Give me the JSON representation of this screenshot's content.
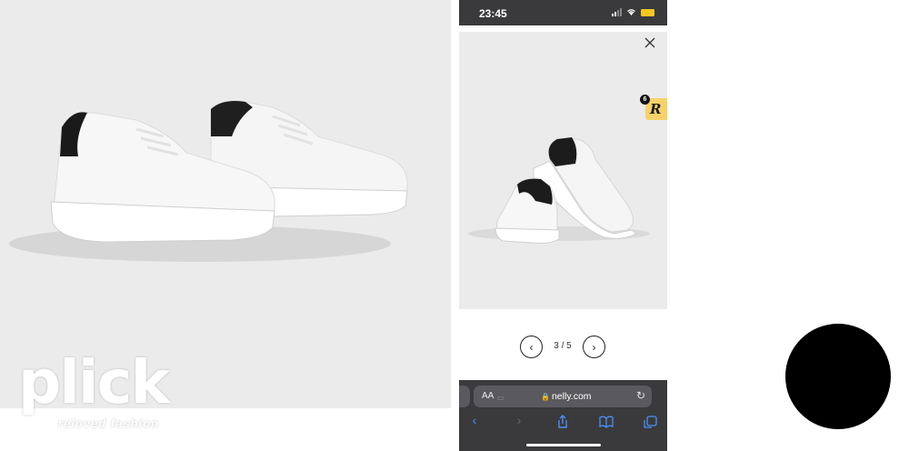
{
  "watermark": {
    "brand": "plick",
    "tagline": "reloved fashion"
  },
  "phone": {
    "status_bar": {
      "time": "23:45"
    },
    "product": {
      "badge_count": "6",
      "badge_letter": "R"
    },
    "pager": {
      "text": "3 / 5",
      "prev_icon": "‹",
      "next_icon": "›"
    },
    "browser": {
      "aa_label": "AA",
      "url": "nelly.com",
      "toolbar_icons": [
        "back-icon",
        "forward-icon",
        "share-icon",
        "bookmarks-icon",
        "tabs-icon"
      ]
    }
  },
  "colors": {
    "status_bar": "#3a3a3c",
    "photo_bg": "#ebebeb",
    "badge": "#f7d26b",
    "toolbar_accent": "#4a90f5",
    "circle": "#000000"
  }
}
